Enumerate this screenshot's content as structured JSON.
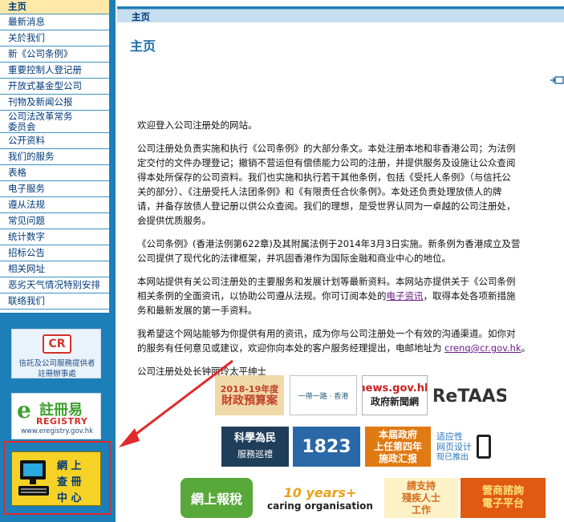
{
  "sidebar": {
    "items": [
      {
        "label": "主页",
        "active": true
      },
      {
        "label": "最新消息"
      },
      {
        "label": "关於我们"
      },
      {
        "label": "新《公司条例》"
      },
      {
        "label": "重要控制人登记册"
      },
      {
        "label": "开放式基金型公司"
      },
      {
        "label": "刊物及新闻公报"
      },
      {
        "label": "公司法改革常务委员会"
      },
      {
        "label": "公开资料"
      },
      {
        "label": "我们的服务"
      },
      {
        "label": "表格"
      },
      {
        "label": "电子服务"
      },
      {
        "label": "遵从法规"
      },
      {
        "label": "常见问题"
      },
      {
        "label": "统计数字"
      },
      {
        "label": "招标公告"
      },
      {
        "label": "相关网址"
      },
      {
        "label": "恶劣天气情况特别安排"
      },
      {
        "label": "联络我们"
      }
    ],
    "banners": {
      "cr_logo_text": "CR",
      "cr_caption_1": "信託及公司服務提供者",
      "cr_caption_2": "註冊辦事處",
      "ereg_title": "註冊易",
      "ereg_sub": "REGISTRY",
      "ereg_url": "www.eregistry.gov.hk",
      "search_line1": "網 上",
      "search_line2": "查 冊",
      "search_line3": "中 心"
    }
  },
  "header": {
    "breadcrumb": "主页",
    "page_title": "主页",
    "share_icon": "share-icon"
  },
  "content": {
    "p1": "欢迎登入公司注册处的网站。",
    "p2_lines": [
      "公司注册处负责实施和执行《公司条例》的大部分条文。本处注册本地和非香港公司；为法例",
      "定交付的文件办理登记；撤销不营运但有偿债能力公司的注册，并提供服务及设施让公众查阅",
      "得本处所保存的公司资料。我们也实施和执行若干其他条例，包括《受托人条例》（与信托公",
      "关的部分）、《注册受托人法团条例》和《有限责任合伙条例》。本处还负责处理放债人的牌",
      "请，并备存放债人登记册以供公众查阅。我们的理想，是受世界认同为一卓越的公司注册处，",
      "会提供优质服务。"
    ],
    "p3_lines": [
      "《公司条例》(香港法例第622章)及其附属法例于2014年3月3日实施。新条例为香港成立及营",
      "公司提供了现代化的法律框架，并巩固香港作为国际金融和商业中心的地位。"
    ],
    "p4_line1": "本网站提供有关公司注册处的主要服务和发展计划等最新资料。本网站亦提供关于《公司条例",
    "p4_line2": "相关条例的全面资讯，以协助公司遵从法规。你可订阅本处的",
    "p4_link": "电子资讯",
    "p4_line2_after": "，取得本处各项新措施",
    "p4_line3": "务和最新发展的第一手资料。",
    "p5_line1": "我希望这个网站能够为你提供有用的资讯，成为你与公司注册处一个有效的沟通渠道。如你对",
    "p5_line2": "的服务有任何意见或建议，欢迎你向本处的客户服务经理提出，电邮地址为 ",
    "p5_email": "crenq@cr.gov.hk",
    "p5_end": "。",
    "signature": "公司注册处处长钟丽玲太平绅士"
  },
  "logos": {
    "budget_1": "2018-19年度",
    "budget_2": "財政預算案",
    "belt": "一帶一路 · 香港",
    "news_1": "news.gov.hk",
    "news_2": "政府新聞網",
    "retaas": "ReTAAS",
    "science_1": "科學為民",
    "science_2": "服務巡禮",
    "hotline": "1823",
    "policy_1": "本屆政府",
    "policy_2": "上任第四年",
    "policy_3": "施政汇报",
    "adaptive_1": "适应性",
    "adaptive_2": "网页设计",
    "adaptive_3": "现已推出",
    "etax": "網上報稅",
    "caring_1": "10 years+",
    "caring_2": "caring organisation",
    "disabled_1": "請支持",
    "disabled_2": "殘疾人士",
    "disabled_3": "工作",
    "platform_1": "營商諮詢",
    "platform_2": "電子平台"
  }
}
